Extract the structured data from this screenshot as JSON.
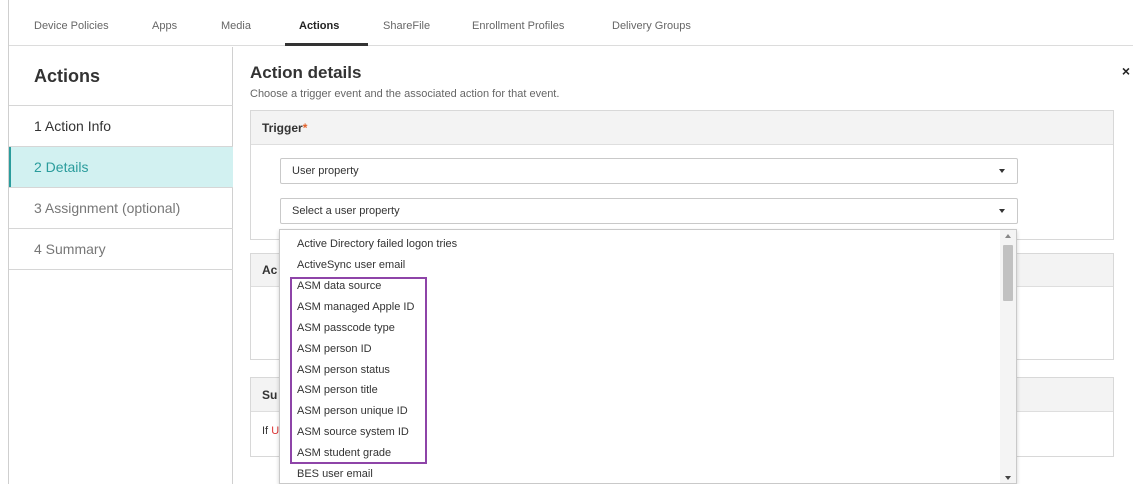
{
  "nav": {
    "tabs": [
      "Device Policies",
      "Apps",
      "Media",
      "Actions",
      "ShareFile",
      "Enrollment Profiles",
      "Delivery Groups"
    ],
    "active": "Actions"
  },
  "sidebar": {
    "title": "Actions",
    "steps": [
      "1  Action Info",
      "2  Details",
      "3  Assignment (optional)",
      "4  Summary"
    ],
    "active_step": "2  Details"
  },
  "main": {
    "title": "Action details",
    "subtitle": "Choose a trigger event and the associated action for that event.",
    "close_glyph": "×",
    "trigger": {
      "label": "Trigger",
      "required_mark": "*",
      "type_select": "User property",
      "property_select_placeholder": "Select a user property"
    },
    "action_stub": "Ac",
    "summary_stub": "Su",
    "summary_if": "If",
    "summary_if_mark": "U"
  },
  "dropdown": {
    "options": [
      "Active Directory failed logon tries",
      "ActiveSync user email",
      "ASM data source",
      "ASM managed Apple ID",
      "ASM passcode type",
      "ASM person ID",
      "ASM person status",
      "ASM person title",
      "ASM person unique ID",
      "ASM source system ID",
      "ASM student grade",
      "BES user email"
    ]
  },
  "colors": {
    "accent": "#2a9c9c",
    "active_step_bg": "#d2f1f1",
    "required": "#e2612a",
    "highlight": "#8e44a8"
  }
}
